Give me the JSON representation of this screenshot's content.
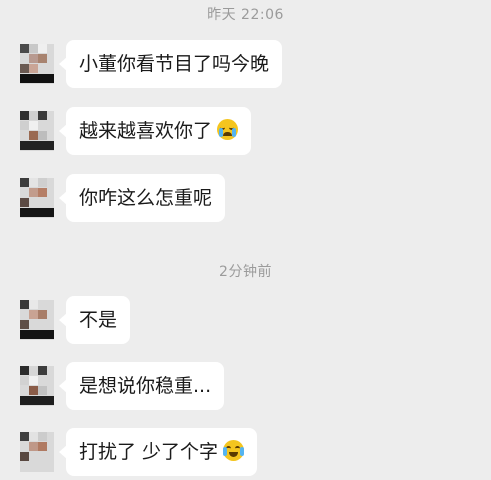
{
  "chat": {
    "timestamps": [
      "昨天 22:06",
      "2分钟前"
    ],
    "messages": [
      {
        "text": "小董你看节目了吗今晚",
        "emoji": ""
      },
      {
        "text": "越来越喜欢你了",
        "emoji": "crying-face-icon"
      },
      {
        "text": "你咋这么怎重呢",
        "emoji": ""
      },
      {
        "text": "不是",
        "emoji": ""
      },
      {
        "text": "是想说你稳重...",
        "emoji": ""
      },
      {
        "text": "打扰了 少了个字",
        "emoji": "laughing-tears-icon"
      }
    ]
  },
  "colors": {
    "background": "#ededed",
    "bubble": "#ffffff",
    "timestamp_text": "#9b9b9b",
    "message_text": "#1a1a1a"
  }
}
